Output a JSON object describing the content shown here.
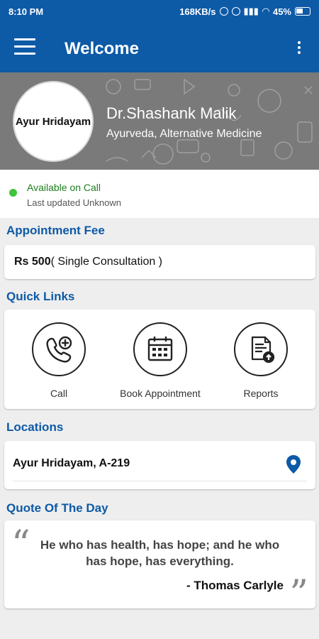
{
  "status_bar": {
    "time": "8:10 PM",
    "network_speed": "168KB/s",
    "battery": "45%"
  },
  "app_bar": {
    "title": "Welcome"
  },
  "profile": {
    "avatar_text": "Ayur Hridayam",
    "doctor_name": "Dr.Shashank Malik",
    "specialty": "Ayurveda, Alternative Medicine"
  },
  "availability": {
    "status": "Available on Call",
    "last_updated": "Last updated Unknown",
    "status_color": "#3ec43e"
  },
  "appointment_fee": {
    "heading": "Appointment Fee",
    "amount": "Rs 500",
    "description": "( Single Consultation )"
  },
  "quick_links": {
    "heading": "Quick Links",
    "items": [
      {
        "label": "Call",
        "icon": "phone-add-icon"
      },
      {
        "label": "Book Appointment",
        "icon": "calendar-icon"
      },
      {
        "label": "Reports",
        "icon": "document-upload-icon"
      }
    ]
  },
  "locations": {
    "heading": "Locations",
    "items": [
      {
        "name": "Ayur Hridayam, A-219",
        "icon": "location-pin-icon"
      }
    ]
  },
  "quote": {
    "heading": "Quote Of The Day",
    "text": "He who has health, has hope; and he who has hope, has everything.",
    "author": "- Thomas Carlyle"
  },
  "colors": {
    "primary": "#0d5aa7",
    "accent_green": "#3ec43e"
  }
}
